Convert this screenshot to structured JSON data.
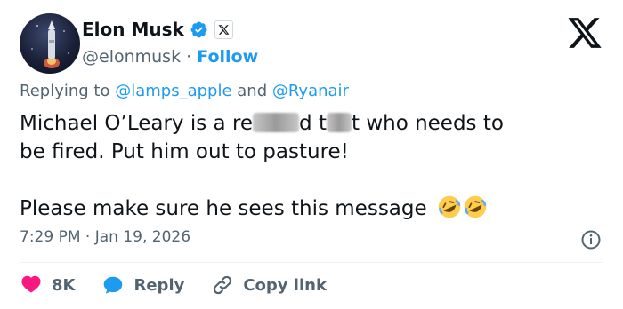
{
  "author": {
    "name": "Elon Musk",
    "handle": "@elonmusk",
    "separator": "·",
    "follow_label": "Follow",
    "verified_color": "#1d9bf0"
  },
  "replying": {
    "prefix": "Replying to",
    "user1": "@lamps_apple",
    "conjunction": "and",
    "user2": "@Ryanair"
  },
  "tweet": {
    "line1_a": "Michael O’Leary is a re",
    "line1_b": "d t",
    "line1_c": "t who needs to",
    "line2": "be fired. Put him out to pasture!",
    "line3": "Please make sure he sees this message"
  },
  "meta": {
    "time": "7:29 PM",
    "separator": "·",
    "date": "Jan 19, 2026"
  },
  "actions": {
    "likes": "8K",
    "reply_label": "Reply",
    "copy_label": "Copy link"
  },
  "colors": {
    "accent": "#1d9bf0",
    "like": "#f91880",
    "text": "#0f1419",
    "muted": "#536471"
  }
}
